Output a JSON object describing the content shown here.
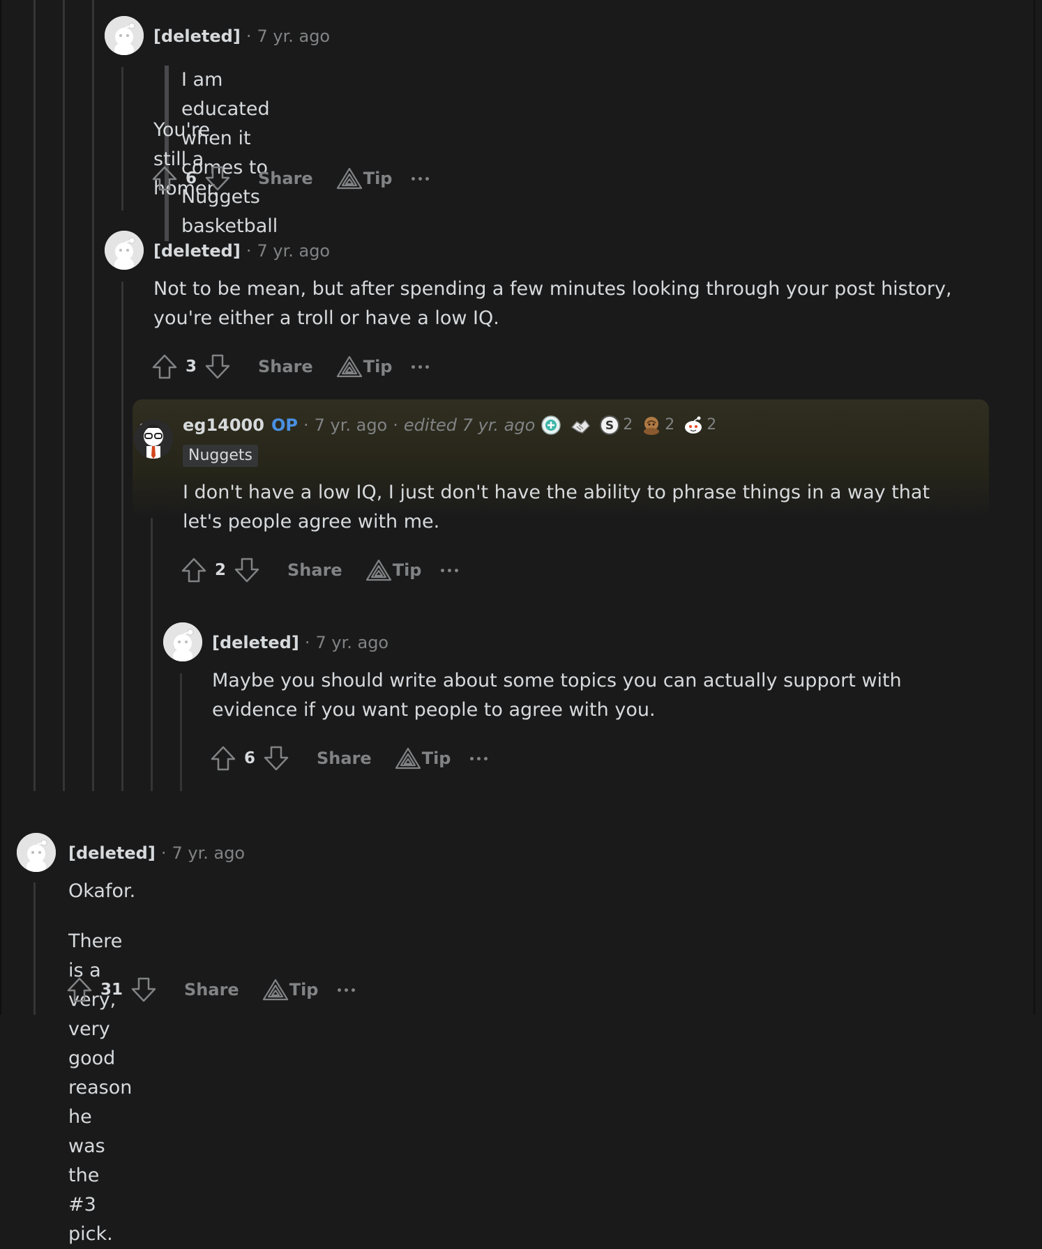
{
  "comments": [
    {
      "author": "[deleted]",
      "time": "7 yr. ago",
      "quote": "I am educated when it comes to Nuggets basketball",
      "paragraphs": [
        "You're still a homer."
      ],
      "score": "6"
    },
    {
      "author": "[deleted]",
      "time": "7 yr. ago",
      "paragraphs": [
        "Not to be mean, but after spending a few minutes looking through your post history, you're either a troll or have a low IQ."
      ],
      "score": "3"
    },
    {
      "author": "eg14000",
      "op_badge": "OP",
      "time": "7 yr. ago",
      "edited": "edited 7 yr. ago",
      "flair": "Nuggets",
      "awards": [
        {
          "icon": "helpful-award-icon",
          "count": ""
        },
        {
          "icon": "handshake-award-icon",
          "count": ""
        },
        {
          "icon": "silver-award-icon",
          "count": "2"
        },
        {
          "icon": "facepalm-award-icon",
          "count": "2"
        },
        {
          "icon": "snoo-award-icon",
          "count": "2"
        }
      ],
      "paragraphs": [
        "I don't have a low IQ, I just don't have the ability to phrase things in a way that let's people agree with me."
      ],
      "score": "2"
    },
    {
      "author": "[deleted]",
      "time": "7 yr. ago",
      "paragraphs": [
        "Maybe you should write about some topics you can actually support with evidence if you want people to agree with you."
      ],
      "score": "6"
    },
    {
      "author": "[deleted]",
      "time": "7 yr. ago",
      "paragraphs": [
        "Okafor.",
        "There is a very, very good reason he was the #3 pick."
      ],
      "score": "31"
    }
  ],
  "actions": {
    "share_label": "Share",
    "tip_label": "Tip",
    "upvote_icon": "upvote-icon",
    "downvote_icon": "downvote-icon",
    "more_icon": "more-options-icon"
  },
  "colors": {
    "background": "#1a1a1b",
    "text": "#d7dadc",
    "muted": "#818384",
    "op": "#4a90e2",
    "rail": "#343536"
  }
}
